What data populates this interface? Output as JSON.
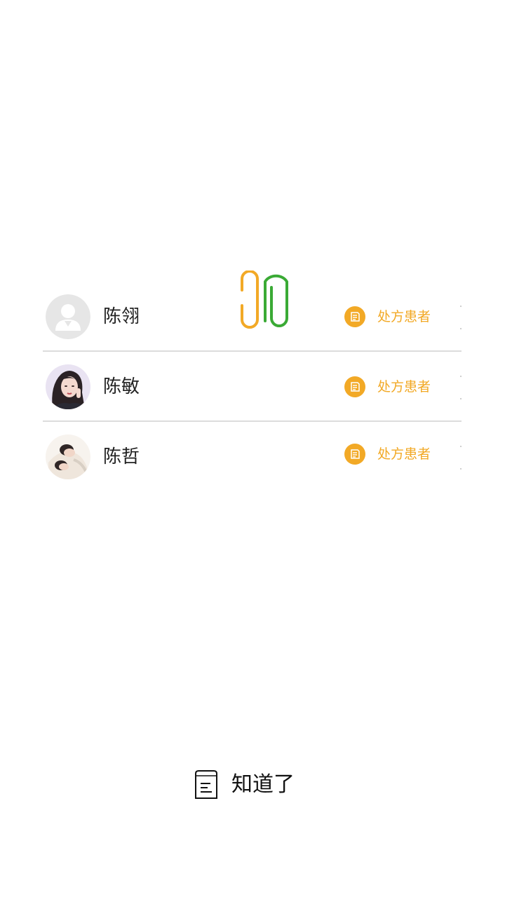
{
  "patients": [
    {
      "name": "陈翎",
      "tag": "处方患者",
      "avatar": "default-avatar"
    },
    {
      "name": "陈敏",
      "tag": "处方患者",
      "avatar": "photo-avatar"
    },
    {
      "name": "陈哲",
      "tag": "处方患者",
      "avatar": "photo-avatar"
    }
  ],
  "colors": {
    "accent": "#f2a926",
    "clip_left": "#f2a926",
    "clip_right": "#3aaa35",
    "divider": "#dcdcdc"
  },
  "icons": {
    "tag_icon": "prescription-icon",
    "ok_icon": "document-icon",
    "decoration": "paperclip-icon"
  },
  "footer": {
    "ok_label": "知道了"
  }
}
